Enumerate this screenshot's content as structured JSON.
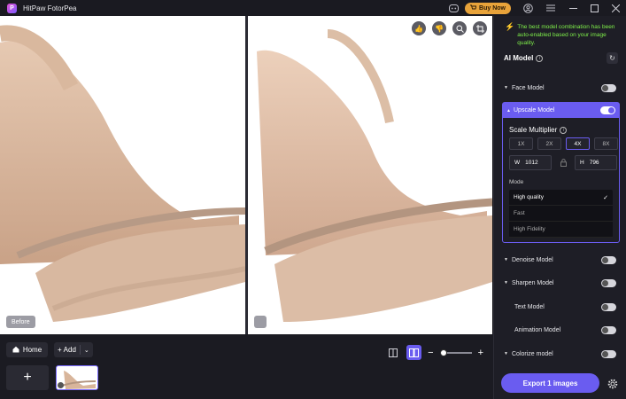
{
  "app": {
    "title": "HitPaw FotorPea",
    "logo_letter": "P"
  },
  "titlebar": {
    "buy_label": "Buy Now"
  },
  "viewer": {
    "before_label": "Before"
  },
  "bottom": {
    "home_label": "Home",
    "add_label": "Add",
    "plus_glyph": "+"
  },
  "panel": {
    "notice": "The best model combination has been auto-enabled based on your image quality.",
    "ai_model_title": "AI Model",
    "models": {
      "face": {
        "label": "Face Model",
        "enabled": false
      },
      "upscale": {
        "label": "Upscale Model",
        "enabled": true
      },
      "denoise": {
        "label": "Denoise Model",
        "enabled": false
      },
      "sharpen": {
        "label": "Sharpen Model",
        "enabled": false
      },
      "text": {
        "label": "Text Model",
        "enabled": false
      },
      "animation": {
        "label": "Animation Model",
        "enabled": false
      },
      "colorize": {
        "label": "Colorize model",
        "enabled": false
      }
    },
    "upscale": {
      "scale_title": "Scale Multiplier",
      "scales": [
        "1X",
        "2X",
        "4X",
        "8X"
      ],
      "selected_scale": "4X",
      "width_label": "W",
      "width_value": "1012",
      "height_label": "H",
      "height_value": "796",
      "mode_label": "Mode",
      "modes": [
        "High quality",
        "Fast",
        "High Fidelity"
      ],
      "selected_mode": "High quality"
    },
    "export_label": "Export 1 images"
  },
  "colors": {
    "accent": "#6a5cf0",
    "buy": "#e8a33a",
    "notice": "#7ff04a"
  }
}
